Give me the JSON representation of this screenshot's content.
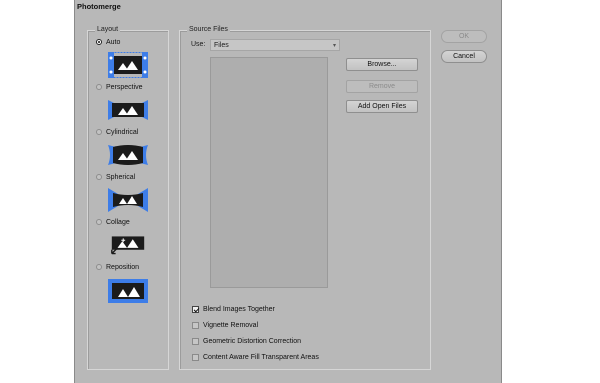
{
  "dialog": {
    "title": "Photomerge"
  },
  "layout": {
    "label": "Layout",
    "options": [
      {
        "label": "Auto",
        "checked": true,
        "icon": "auto-layout-icon"
      },
      {
        "label": "Perspective",
        "checked": false,
        "icon": "perspective-layout-icon"
      },
      {
        "label": "Cylindrical",
        "checked": false,
        "icon": "cylindrical-layout-icon"
      },
      {
        "label": "Spherical",
        "checked": false,
        "icon": "spherical-layout-icon"
      },
      {
        "label": "Collage",
        "checked": false,
        "icon": "collage-layout-icon"
      },
      {
        "label": "Reposition",
        "checked": false,
        "icon": "reposition-layout-icon"
      }
    ]
  },
  "source": {
    "label": "Source Files",
    "use_label": "Use:",
    "use_value": "Files",
    "browse_label": "Browse...",
    "remove_label": "Remove",
    "add_open_label": "Add Open Files"
  },
  "options": [
    {
      "label": "Blend Images Together",
      "checked": true
    },
    {
      "label": "Vignette Removal",
      "checked": false
    },
    {
      "label": "Geometric Distortion Correction",
      "checked": false
    },
    {
      "label": "Content Aware Fill Transparent Areas",
      "checked": false
    }
  ],
  "actions": {
    "ok_label": "OK",
    "cancel_label": "Cancel"
  },
  "colors": {
    "accent": "#3d7de8",
    "thumb_dark": "#1b1b1b",
    "dialog_bg": "#b8b8b8"
  }
}
